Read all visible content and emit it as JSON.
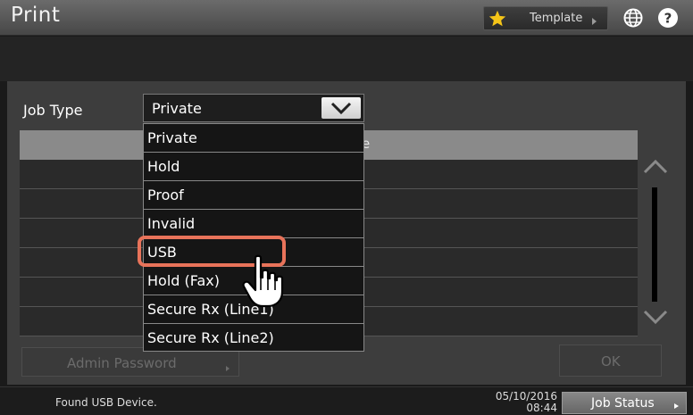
{
  "header": {
    "title": "Print",
    "template_label": "Template",
    "icons": [
      "star-icon",
      "globe-icon",
      "help-icon"
    ]
  },
  "job_type": {
    "label": "Job Type",
    "selected": "Private",
    "options": [
      "Private",
      "Hold",
      "Proof",
      "Invalid",
      "USB",
      "Hold (Fax)",
      "Secure Rx (Line1)",
      "Secure Rx (Line2)"
    ],
    "highlighted_option": "USB"
  },
  "table": {
    "header_partial": "e"
  },
  "buttons": {
    "admin_password": "Admin Password",
    "ok": "OK",
    "job_status": "Job Status"
  },
  "status": {
    "message": "Found USB Device.",
    "date": "05/10/2016",
    "time": "08:44"
  },
  "colors": {
    "highlight": "#e8735a",
    "star": "#f5c518"
  }
}
